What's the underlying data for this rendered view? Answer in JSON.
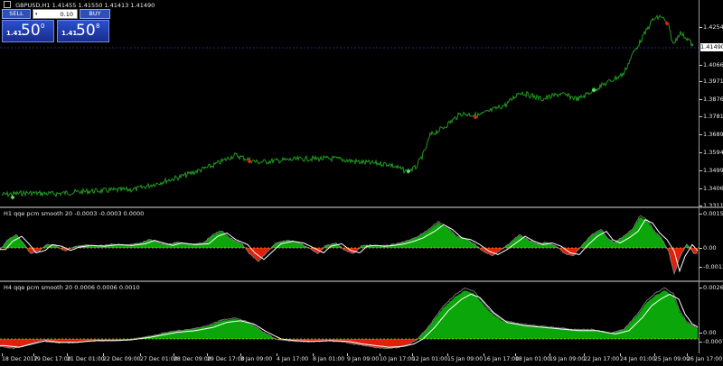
{
  "chart": {
    "symbol_info": "GBPUSD,H1",
    "ohlc_values": "1.41455 1.41550 1.41413 1.41490",
    "current_price_label": "1.41490",
    "price_scale": [
      "1.42540",
      "1.41490",
      "1.40665",
      "1.39710",
      "1.38765",
      "1.37815",
      "1.36890",
      "1.35940",
      "1.34990",
      "1.34065",
      "1.33115"
    ],
    "time_axis": [
      "18 Dec 2017",
      "19 Dec 17:00",
      "21 Dec 01:00",
      "22 Dec 09:00",
      "27 Dec 01:00",
      "28 Dec 09:00",
      "29 Dec 17:00",
      "3 Jan 09:00",
      "4 Jan 17:00",
      "8 Jan 01:00",
      "9 Jan 09:00",
      "10 Jan 17:00",
      "12 Jan 01:00",
      "15 Jan 09:00",
      "16 Jan 17:00",
      "18 Jan 01:00",
      "19 Jan 09:00",
      "22 Jan 17:00",
      "24 Jan 01:00",
      "25 Jan 09:00",
      "26 Jan 17:00"
    ],
    "colors": {
      "price_line": "#1f9a1f",
      "bull_hist": "#0aa60a",
      "bear_hist": "#e0200a",
      "signal_line": "#ffffff",
      "zero_line": "#c8c800",
      "marker_green": "#6dd56d",
      "marker_red": "#e0200a"
    }
  },
  "one_click": {
    "sell_label": "SELL",
    "buy_label": "BUY",
    "lot_value": "0.10",
    "sell_prefix": "1.41",
    "sell_big": "50",
    "sell_sup": "0",
    "buy_prefix": "1.41",
    "buy_big": "50",
    "buy_sup": "8"
  },
  "indicator1": {
    "title": "H1  qqe pcm smooth  20 -0.0003 -0.0003 0.0000",
    "scale": [
      "0.0015",
      "0.00",
      "-0.0013"
    ]
  },
  "indicator2": {
    "title": "H4  qqe pcm smooth  20 0.0006 0.0006 0.0010",
    "scale": [
      "0.0026",
      "0.00",
      "-0.0007"
    ]
  }
}
